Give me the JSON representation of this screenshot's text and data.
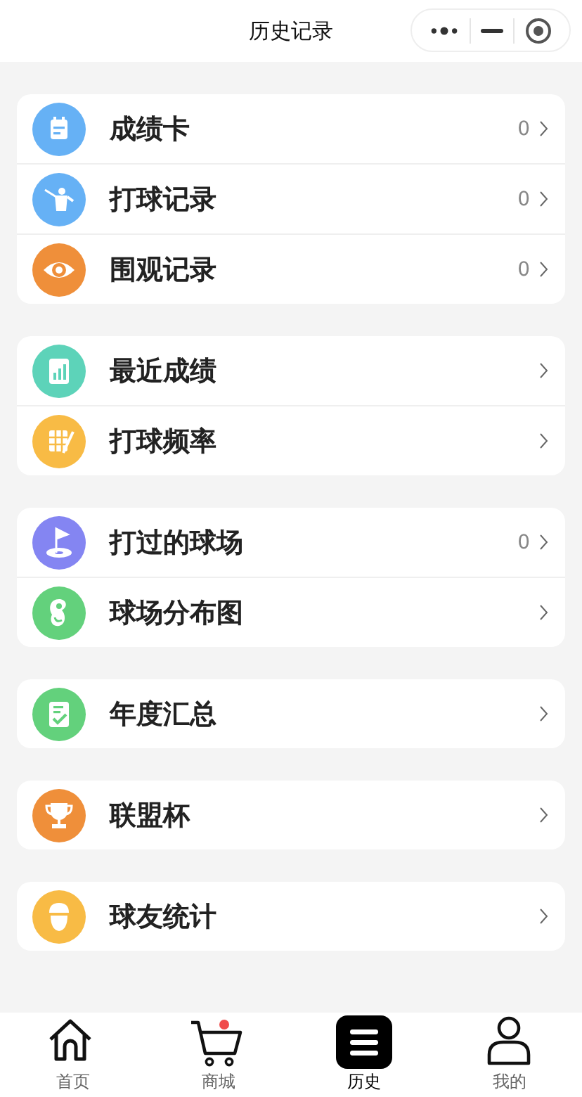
{
  "header": {
    "title": "历史记录"
  },
  "groups": [
    {
      "items": [
        {
          "kind": "calendar",
          "color": "#66b1f5",
          "label": "成绩卡",
          "count": "0"
        },
        {
          "kind": "golfer",
          "color": "#66b1f5",
          "label": "打球记录",
          "count": "0"
        },
        {
          "kind": "eye",
          "color": "#ef8f3a",
          "label": "围观记录",
          "count": "0"
        }
      ]
    },
    {
      "items": [
        {
          "kind": "chart",
          "color": "#5dd3b9",
          "label": "最近成绩"
        },
        {
          "kind": "grid",
          "color": "#f8bb45",
          "label": "打球频率"
        }
      ]
    },
    {
      "items": [
        {
          "kind": "flag",
          "color": "#8485f2",
          "label": "打过的球场",
          "count": "0"
        },
        {
          "kind": "pin",
          "color": "#63d17c",
          "label": "球场分布图"
        }
      ]
    },
    {
      "items": [
        {
          "kind": "checklist",
          "color": "#63d17c",
          "label": "年度汇总"
        }
      ]
    },
    {
      "items": [
        {
          "kind": "trophy",
          "color": "#ef8f3a",
          "label": "联盟杯"
        }
      ]
    },
    {
      "items": [
        {
          "kind": "person",
          "color": "#f8bb45",
          "label": "球友统计"
        }
      ]
    }
  ],
  "tabs": [
    {
      "kind": "home",
      "label": "首页",
      "selected": false,
      "badge": false
    },
    {
      "kind": "cart",
      "label": "商城",
      "selected": false,
      "badge": true
    },
    {
      "kind": "list",
      "label": "历史",
      "selected": true,
      "badge": false
    },
    {
      "kind": "user",
      "label": "我的",
      "selected": false,
      "badge": false
    }
  ]
}
